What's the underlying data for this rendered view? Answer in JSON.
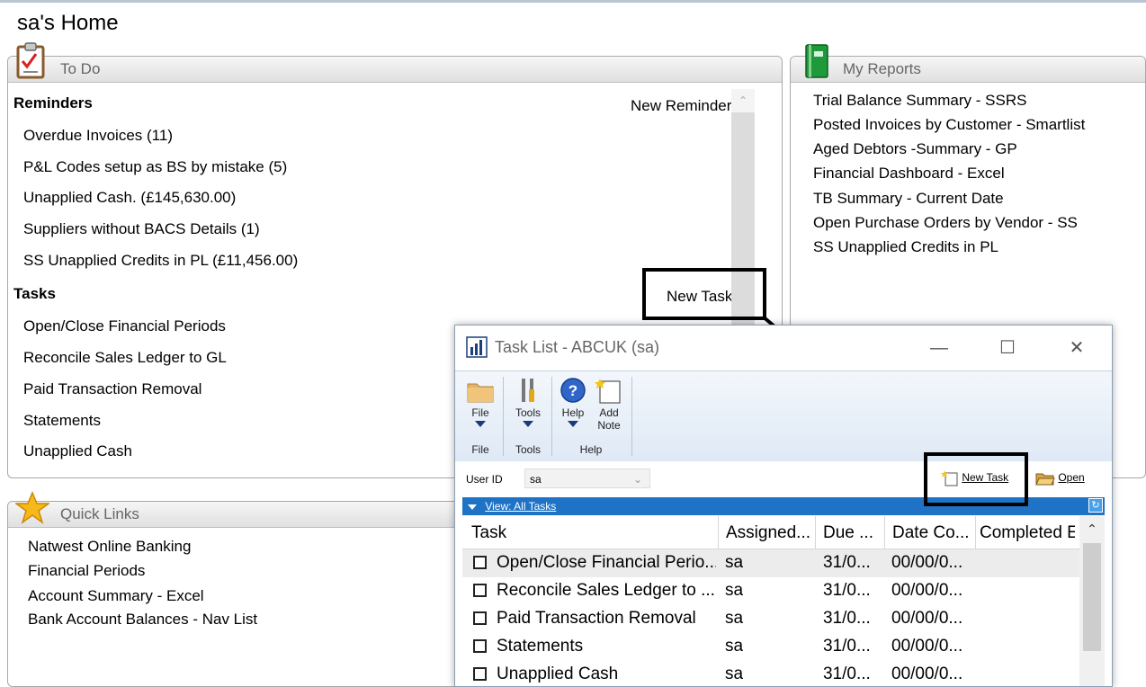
{
  "page": {
    "title": "sa's Home"
  },
  "todo": {
    "title": "To Do",
    "reminders_heading": "Reminders",
    "new_reminder": "New Reminder..",
    "reminders": [
      "Overdue Invoices (11)",
      "P&L Codes setup as BS by mistake (5)",
      "Unapplied Cash. (£145,630.00)",
      "Suppliers without BACS Details (1)",
      "SS Unapplied Credits in PL (£11,456.00)"
    ],
    "tasks_heading": "Tasks",
    "new_task": "New Task..",
    "tasks": [
      "Open/Close Financial Periods",
      "Reconcile  Sales Ledger to GL",
      "Paid Transaction Removal",
      "Statements",
      "Unapplied Cash"
    ]
  },
  "reports": {
    "title": "My Reports",
    "items": [
      "Trial Balance Summary - SSRS",
      "Posted Invoices by Customer - Smartlist",
      "Aged Debtors -Summary - GP",
      "Financial Dashboard - Excel",
      "TB Summary -  Current Date",
      "Open Purchase Orders by Vendor - SS",
      "SS Unapplied Credits in PL"
    ]
  },
  "quick_links": {
    "title": "Quick Links",
    "items": [
      "Natwest Online Banking",
      "Financial Periods",
      "Account Summary - Excel",
      "Bank Account Balances - Nav List"
    ]
  },
  "task_window": {
    "title": "Task List  -  ABCUK (sa)",
    "ribbon": {
      "file_label": "File",
      "tools_label": "Tools",
      "help_label": "Help",
      "add_note_line1": "Add",
      "add_note_line2": "Note",
      "group_file": "File",
      "group_tools": "Tools",
      "group_help": "Help"
    },
    "user_id_label": "User ID",
    "user_id_value": "sa",
    "new_task_label": "New Task",
    "open_label": "Open",
    "view_label": "View: All Tasks",
    "columns": [
      "Task",
      "Assigned...",
      "Due ...",
      "Date Co...",
      "Completed E"
    ],
    "rows": [
      {
        "task": "Open/Close Financial Perio...",
        "assigned": "sa",
        "due": "31/0...",
        "completed": "00/00/0..."
      },
      {
        "task": "Reconcile  Sales Ledger to ...",
        "assigned": "sa",
        "due": "31/0...",
        "completed": "00/00/0..."
      },
      {
        "task": "Paid Transaction Removal",
        "assigned": "sa",
        "due": "31/0...",
        "completed": "00/00/0..."
      },
      {
        "task": "Statements",
        "assigned": "sa",
        "due": "31/0...",
        "completed": "00/00/0..."
      },
      {
        "task": "Unapplied Cash",
        "assigned": "sa",
        "due": "31/0...",
        "completed": "00/00/0..."
      }
    ]
  },
  "colors": {
    "view_bar": "#1e73c6",
    "panel_header": "#e6e6e6",
    "callout": "#000000"
  }
}
